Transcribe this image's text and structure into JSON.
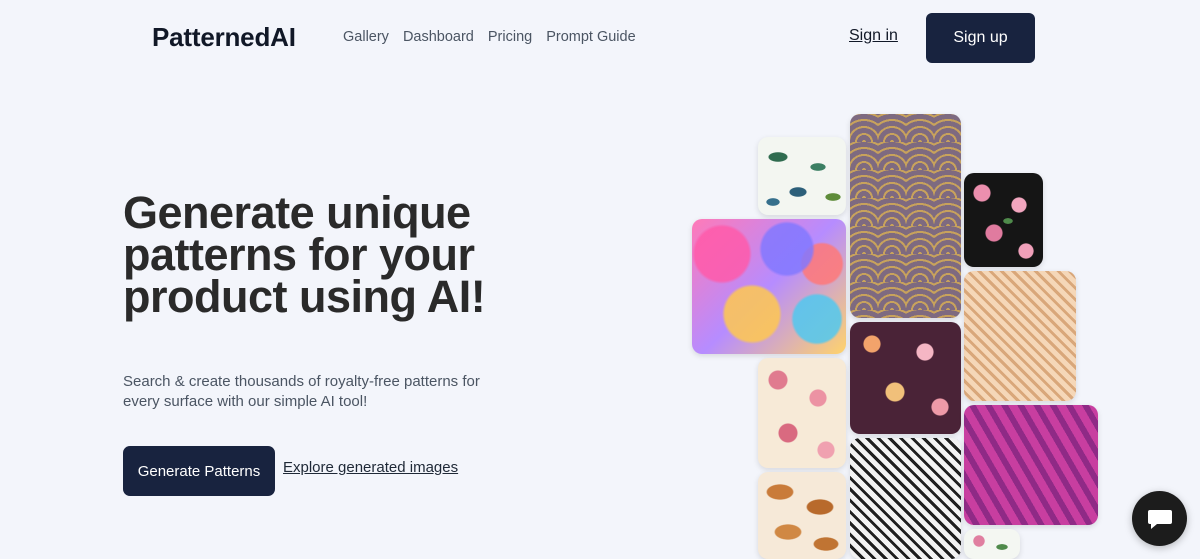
{
  "header": {
    "logo": "PatternedAI",
    "nav": [
      {
        "label": "Gallery"
      },
      {
        "label": "Dashboard"
      },
      {
        "label": "Pricing"
      },
      {
        "label": "Prompt Guide"
      }
    ],
    "sign_in": "Sign in",
    "sign_up": "Sign up"
  },
  "hero": {
    "title": "Generate unique patterns for your product using AI!",
    "subtitle": "Search & create thousands of royalty-free patterns for every surface with our simple AI tool!",
    "cta_primary": "Generate Patterns",
    "cta_secondary": "Explore generated images"
  },
  "gallery": {
    "tiles": [
      {
        "icon": "watercolor-leaves-pattern"
      },
      {
        "icon": "art-deco-fan-pattern"
      },
      {
        "icon": "pink-roses-on-black-pattern"
      },
      {
        "icon": "colorful-bubbles-pattern"
      },
      {
        "icon": "peach-geometric-diamond-pattern"
      },
      {
        "icon": "pink-roses-on-cream-pattern"
      },
      {
        "icon": "floral-on-plum-pattern"
      },
      {
        "icon": "magenta-lattice-pattern"
      },
      {
        "icon": "black-white-diamond-pattern"
      },
      {
        "icon": "pastries-pattern"
      },
      {
        "icon": "pink-flowers-on-white-pattern"
      }
    ]
  },
  "chat": {
    "icon": "chat-bubble-icon"
  },
  "colors": {
    "primary": "#18233f",
    "background": "#f3f5fb"
  }
}
